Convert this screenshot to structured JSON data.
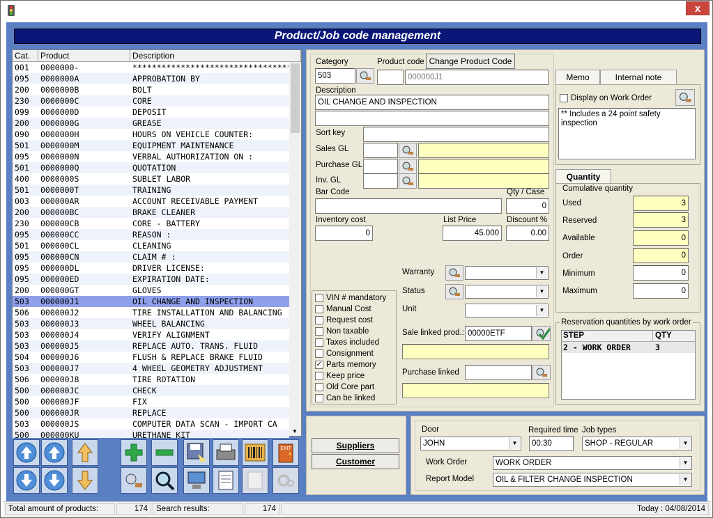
{
  "window": {
    "close_label": "x"
  },
  "banner": {
    "title": "Product/Job code management"
  },
  "list": {
    "headers": [
      "Cat.",
      "Product",
      "Description"
    ],
    "rows": [
      [
        "001",
        "0000000-",
        "************************************"
      ],
      [
        "095",
        "0000000A",
        "APPROBATION BY"
      ],
      [
        "200",
        "0000000B",
        "BOLT"
      ],
      [
        "230",
        "0000000C",
        "CORE"
      ],
      [
        "099",
        "0000000D",
        "DEPOSIT"
      ],
      [
        "200",
        "0000000G",
        "GREASE"
      ],
      [
        "090",
        "0000000H",
        "HOURS ON VEHICLE COUNTER:"
      ],
      [
        "501",
        "0000000M",
        "EQUIPMENT MAINTENANCE"
      ],
      [
        "095",
        "0000000N",
        "VERBAL AUTHORIZATION ON :"
      ],
      [
        "501",
        "0000000Q",
        "QUOTATION"
      ],
      [
        "400",
        "0000000S",
        "SUBLET LABOR"
      ],
      [
        "501",
        "0000000T",
        "TRAINING"
      ],
      [
        "003",
        "000000AR",
        "ACCOUNT RECEIVABLE PAYMENT"
      ],
      [
        "200",
        "000000BC",
        "BRAKE CLEANER"
      ],
      [
        "230",
        "000000CB",
        "CORE - BATTERY"
      ],
      [
        "095",
        "000000CC",
        "REASON :"
      ],
      [
        "501",
        "000000CL",
        "CLEANING"
      ],
      [
        "095",
        "000000CN",
        "CLAIM # :"
      ],
      [
        "095",
        "000000DL",
        "DRIVER LICENSE:"
      ],
      [
        "095",
        "000000ED",
        "EXPIRATION DATE:"
      ],
      [
        "200",
        "000000GT",
        "GLOVES"
      ],
      [
        "503",
        "000000J1",
        "OIL CHANGE AND INSPECTION"
      ],
      [
        "506",
        "000000J2",
        "TIRE INSTALLATION AND BALANCING"
      ],
      [
        "503",
        "000000J3",
        "WHEEL BALANCING"
      ],
      [
        "503",
        "000000J4",
        "VERIFY ALIGNMENT"
      ],
      [
        "503",
        "000000J5",
        "REPLACE AUTO. TRANS. FLUID"
      ],
      [
        "504",
        "000000J6",
        "FLUSH & REPLACE BRAKE FLUID"
      ],
      [
        "503",
        "000000J7",
        "4 WHEEL GEOMETRY ADJUSTMENT"
      ],
      [
        "506",
        "000000J8",
        "TIRE ROTATION"
      ],
      [
        "500",
        "000000JC",
        "CHECK"
      ],
      [
        "500",
        "000000JF",
        "FIX"
      ],
      [
        "500",
        "000000JR",
        "REPLACE"
      ],
      [
        "503",
        "000000JS",
        "COMPUTER DATA SCAN - IMPORT CA"
      ],
      [
        "500",
        "000000KU",
        "URETHANE KIT"
      ]
    ],
    "selected_index": 21
  },
  "form": {
    "category_label": "Category",
    "category_value": "503",
    "product_code_label": "Product code",
    "change_code_button": "Change Product Code",
    "product_code_value": "000000J1",
    "description_label": "Description",
    "description_value": "OIL CHANGE AND INSPECTION",
    "description2_value": "",
    "sort_key_label": "Sort key",
    "sales_gl_label": "Sales GL",
    "purchase_gl_label": "Purchase GL",
    "inv_gl_label": "Inv. GL",
    "bar_code_label": "Bar Code",
    "qty_case_label": "Qty / Case",
    "qty_case_value": "0",
    "inventory_cost_label": "Inventory cost",
    "inventory_cost_value": "0",
    "list_price_label": "List Price",
    "list_price_value": "45.000",
    "discount_label": "Discount %",
    "discount_value": "0.00",
    "warranty_label": "Warranty",
    "status_label": "Status",
    "unit_label": "Unit",
    "sale_linked_label": "Sale linked prod.:",
    "sale_linked_value": "00000ETF",
    "purchase_linked_label": "Purchase linked"
  },
  "checkboxes": [
    {
      "label": "VIN # mandatory",
      "checked": false
    },
    {
      "label": "Manual Cost",
      "checked": false
    },
    {
      "label": "Request cost",
      "checked": false
    },
    {
      "label": "Non taxable",
      "checked": false
    },
    {
      "label": "Taxes included",
      "checked": false
    },
    {
      "label": "Consignment",
      "checked": false
    },
    {
      "label": "Parts memory",
      "checked": true
    },
    {
      "label": "Keep price",
      "checked": false
    },
    {
      "label": "Old Core part",
      "checked": false
    },
    {
      "label": "Can be linked",
      "checked": false
    }
  ],
  "memo": {
    "tab_memo": "Memo",
    "tab_internal": "Internal note",
    "display_on_wo": "Display on Work Order",
    "text": "** Includes a 24 point safety inspection"
  },
  "quantity": {
    "tab": "Quantity",
    "group": "Cumulative quantity",
    "used_label": "Used",
    "used": "3",
    "reserved_label": "Reserved",
    "reserved": "3",
    "available_label": "Available",
    "available": "0",
    "order_label": "Order",
    "order": "0",
    "minimum_label": "Minimum",
    "minimum": "0",
    "maximum_label": "Maximum",
    "maximum": "0"
  },
  "reservation": {
    "group": "Reservation quantities by work order",
    "col_step": "STEP",
    "col_qty": "QTY",
    "row_step": "2 - WORK ORDER",
    "row_qty": "3"
  },
  "bottom": {
    "suppliers": "Suppliers",
    "customer": "Customer",
    "door_label": "Door",
    "door": "JOHN",
    "required_time_label": "Required time",
    "required_time": "00:30",
    "job_types_label": "Job types",
    "job_types": "SHOP - REGULAR",
    "work_order_label": "Work Order",
    "work_order": "WORK ORDER",
    "report_model_label": "Report Model",
    "report_model": "OIL & FILTER CHANGE INSPECTION"
  },
  "status": {
    "total_label": "Total amount of products:",
    "total": "174",
    "search_label": "Search results:",
    "search": "174",
    "today": "Today : 04/08/2014"
  },
  "colors": {
    "banner": "#0a1778",
    "frame": "#5a7fc3",
    "selected_row": "#8fa0ea",
    "readonly_field": "#ffffc0"
  }
}
